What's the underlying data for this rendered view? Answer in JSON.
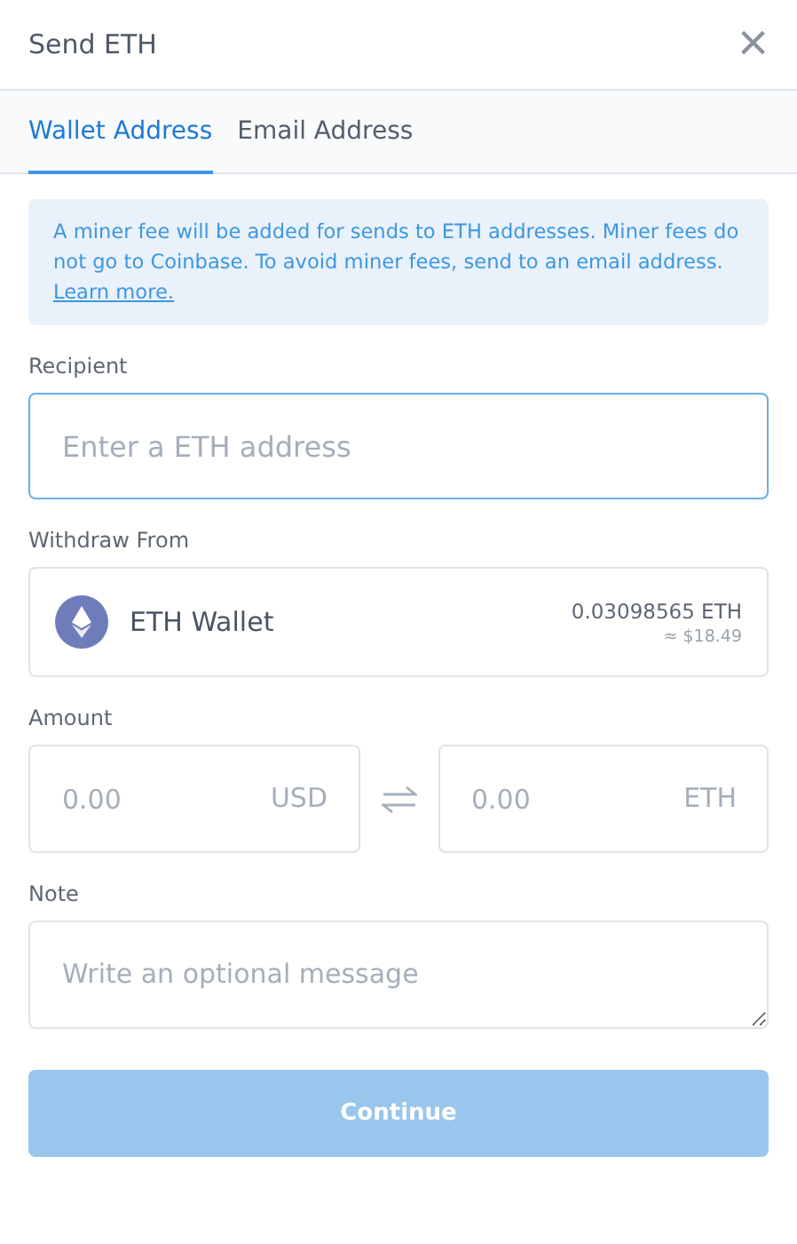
{
  "window": {
    "title": "Send ETH",
    "close": "×"
  },
  "tabs": [
    {
      "label": "Wallet Address",
      "selected": true
    },
    {
      "label": "Email Address",
      "selected": false
    }
  ],
  "notice": {
    "text": "A miner fee will be added for sends to ETH addresses. Miner fees do not go to Coinbase. To avoid miner fees, send to an email address.",
    "link": "Learn more."
  },
  "recipient": {
    "label": "Recipient",
    "placeholder": "Enter a ETH address"
  },
  "withdraw_from": {
    "label": "Withdraw From",
    "wallet": "ETH Wallet",
    "balance": "0.03098565 ETH",
    "fiat": "≈ $18.49"
  },
  "amount": {
    "label": "Amount",
    "fields": [
      {
        "placeholder": "0.00",
        "currency": "USD"
      },
      {
        "placeholder": "0.00",
        "currency": "ETH"
      }
    ]
  },
  "note": {
    "label": "Note",
    "placeholder": "Write an optional message"
  },
  "continue_button": {
    "label": "Continue",
    "disabled": true
  }
}
